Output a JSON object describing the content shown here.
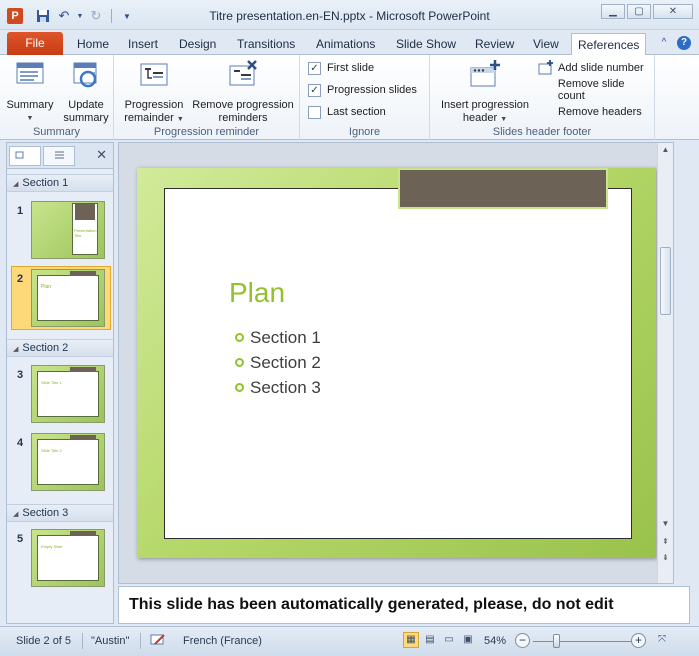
{
  "window": {
    "title": "Titre presentation.en-EN.pptx - Microsoft PowerPoint",
    "app_icon_letter": "P"
  },
  "tabs": {
    "file": "File",
    "items": [
      "Home",
      "Insert",
      "Design",
      "Transitions",
      "Animations",
      "Slide Show",
      "Review",
      "View",
      "References"
    ],
    "active": "References"
  },
  "ribbon": {
    "summary_group": {
      "label": "Summary",
      "summary_btn": "Summary",
      "update_btn_line1": "Update",
      "update_btn_line2": "summary"
    },
    "progression_group": {
      "label": "Progression reminder",
      "progression_btn_line1": "Progression",
      "progression_btn_line2": "remainder",
      "remove_btn_line1": "Remove progression",
      "remove_btn_line2": "reminders"
    },
    "ignore_group": {
      "label": "Ignore",
      "first_slide": "First slide",
      "progression_slides": "Progression slides",
      "last_section": "Last section",
      "first_slide_checked": true,
      "progression_slides_checked": true,
      "last_section_checked": false
    },
    "header_group": {
      "label": "Slides header  footer",
      "insert_btn_line1": "Insert progression",
      "insert_btn_line2": "header",
      "add_slide_number": "Add slide number",
      "remove_slide_count": "Remove slide count",
      "remove_headers": "Remove headers"
    }
  },
  "panel": {
    "sections": [
      {
        "name": "Section 1"
      },
      {
        "name": "Section 2"
      },
      {
        "name": "Section 3"
      }
    ],
    "slides": [
      {
        "num": "1",
        "mini": "Presentation Title"
      },
      {
        "num": "2",
        "mini": "Plan"
      },
      {
        "num": "3",
        "mini": "Slide Title 1"
      },
      {
        "num": "4",
        "mini": "Slide Title 2"
      },
      {
        "num": "5",
        "mini": "Empty Slide"
      }
    ],
    "selected_slide": "2"
  },
  "slide": {
    "title": "Plan",
    "bullets": [
      "Section 1",
      "Section 2",
      "Section 3"
    ]
  },
  "notes": {
    "text": "This slide has been automatically generated, please, do not edit"
  },
  "statusbar": {
    "slide_pos": "Slide 2 of 5",
    "theme": "\"Austin\"",
    "language": "French (France)",
    "zoom": "54%"
  },
  "colors": {
    "accent_green": "#93c12e",
    "file_tab": "#d04a20",
    "slide_tab_dark": "#6d6256"
  }
}
